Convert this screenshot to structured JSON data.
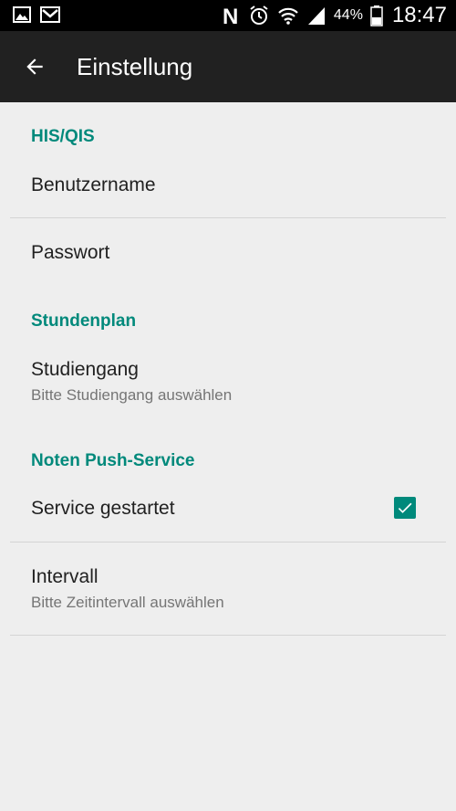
{
  "status_bar": {
    "left_icons": [
      "gallery-icon",
      "gmail-icon"
    ],
    "right_icons": [
      "nfc-icon",
      "alarm-icon",
      "wifi-icon",
      "signal-icon",
      "battery-icon"
    ],
    "battery_percent": "44%",
    "battery_level": 0.44,
    "time": "18:47"
  },
  "app_bar": {
    "title": "Einstellung",
    "back_icon": "arrow-back-icon"
  },
  "settings": {
    "his_qis": {
      "header": "HIS/QIS",
      "username": {
        "title": "Benutzername"
      },
      "password": {
        "title": "Passwort"
      }
    },
    "stundenplan": {
      "header": "Stundenplan",
      "studiengang": {
        "title": "Studiengang",
        "summary": "Bitte Studiengang auswählen"
      }
    },
    "push_service": {
      "header": "Noten Push-Service",
      "service": {
        "title": "Service gestartet",
        "checked": true
      },
      "interval": {
        "title": "Intervall",
        "summary": "Bitte Zeitintervall auswählen"
      }
    }
  },
  "colors": {
    "accent": "#00897b",
    "app_bar": "#212121",
    "background": "#eeeeee",
    "divider": "#d4d4d4"
  }
}
